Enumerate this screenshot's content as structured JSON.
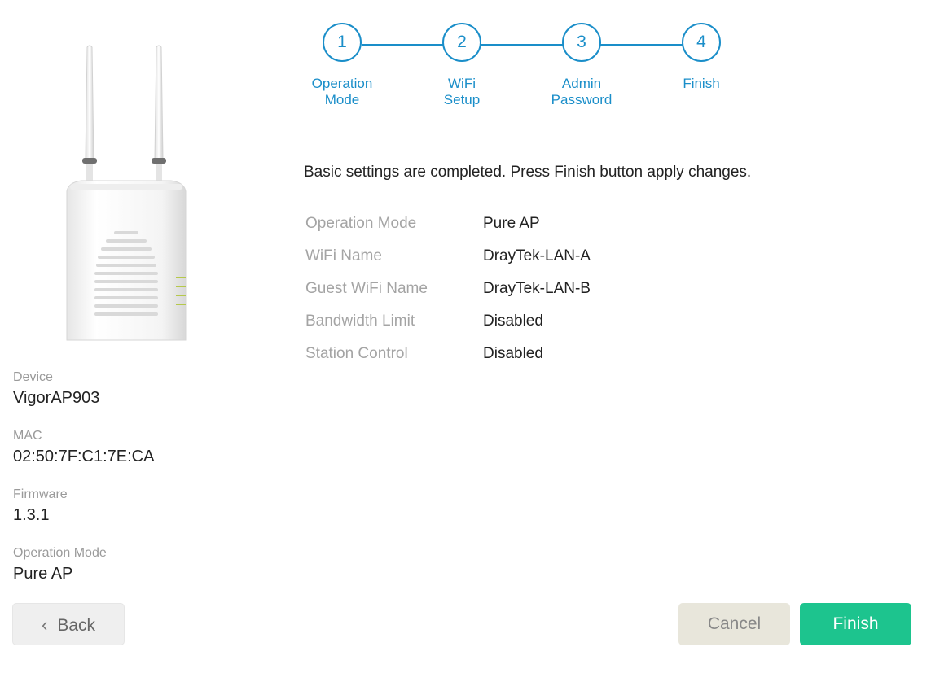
{
  "stepper": {
    "steps": [
      {
        "number": "1",
        "line1": "Operation",
        "line2": "Mode"
      },
      {
        "number": "2",
        "line1": "WiFi",
        "line2": "Setup"
      },
      {
        "number": "3",
        "line1": "Admin",
        "line2": "Password"
      },
      {
        "number": "4",
        "line1": "Finish",
        "line2": ""
      }
    ],
    "accent_color": "#1a8ec9"
  },
  "message": "Basic settings are completed. Press Finish button apply changes.",
  "summary": [
    {
      "label": "Operation Mode",
      "value": "Pure AP"
    },
    {
      "label": "WiFi Name",
      "value": "DrayTek-LAN-A"
    },
    {
      "label": "Guest WiFi Name",
      "value": "DrayTek-LAN-B"
    },
    {
      "label": "Bandwidth Limit",
      "value": "Disabled"
    },
    {
      "label": "Station Control",
      "value": "Disabled"
    }
  ],
  "device_info": {
    "device_label": "Device",
    "device_value": "VigorAP903",
    "mac_label": "MAC",
    "mac_value": "02:50:7F:C1:7E:CA",
    "firmware_label": "Firmware",
    "firmware_value": "1.3.1",
    "mode_label": "Operation Mode",
    "mode_value": "Pure AP"
  },
  "buttons": {
    "back_icon": "chevron-left-icon",
    "back_glyph": "‹",
    "back_label": "Back",
    "cancel_label": "Cancel",
    "finish_label": "Finish",
    "finish_color": "#1dc48e",
    "cancel_color": "#e8e6db"
  }
}
